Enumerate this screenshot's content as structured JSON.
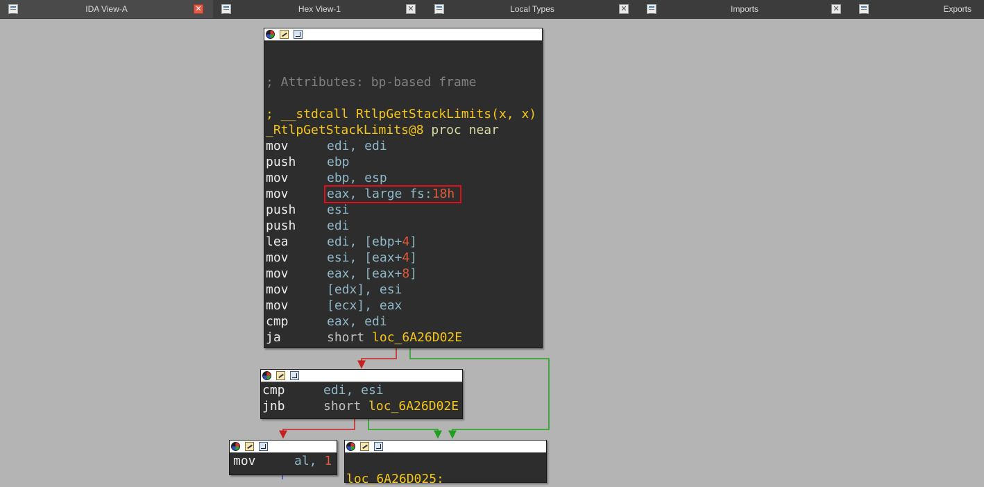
{
  "tabs": [
    {
      "label": "IDA View-A",
      "active": true,
      "close": "✕"
    },
    {
      "label": "Hex View-1",
      "active": false,
      "close": "✕"
    },
    {
      "label": "Local Types",
      "active": false,
      "close": "✕"
    },
    {
      "label": "Imports",
      "active": false,
      "close": "✕"
    },
    {
      "label": "Exports",
      "active": false,
      "close": ""
    }
  ],
  "node_main": {
    "attributes": "; Attributes: bp-based frame",
    "signature": "; __stdcall RtlpGetStackLimits(x, x)",
    "proc_name": "_RtlpGetStackLimits@8",
    "proc_kw": "proc near",
    "instructions": [
      {
        "mnemonic": "mov",
        "operands": "edi, edi"
      },
      {
        "mnemonic": "push",
        "operands": "ebp"
      },
      {
        "mnemonic": "mov",
        "operands": "ebp, esp"
      },
      {
        "mnemonic": "mov",
        "op_a": "eax, large fs:",
        "op_num": "18h"
      },
      {
        "mnemonic": "push",
        "operands": "esi"
      },
      {
        "mnemonic": "push",
        "operands": "edi"
      },
      {
        "mnemonic": "lea",
        "op_a": "edi, [ebp+",
        "op_num": "4",
        "op_b": "]"
      },
      {
        "mnemonic": "mov",
        "op_a": "esi, [eax+",
        "op_num": "4",
        "op_b": "]"
      },
      {
        "mnemonic": "mov",
        "op_a": "eax, [eax+",
        "op_num": "8",
        "op_b": "]"
      },
      {
        "mnemonic": "mov",
        "operands": "[edx], esi"
      },
      {
        "mnemonic": "mov",
        "operands": "[ecx], eax"
      },
      {
        "mnemonic": "cmp",
        "operands": "eax, edi"
      },
      {
        "mnemonic": "ja",
        "op_short": "short ",
        "op_label": "loc_6A26D02E"
      }
    ]
  },
  "node_cmp": {
    "instructions": [
      {
        "mnemonic": "cmp",
        "operands": "edi, esi"
      },
      {
        "mnemonic": "jnb",
        "op_short": "short ",
        "op_label": "loc_6A26D02E"
      }
    ]
  },
  "node_mov": {
    "mnemonic": "mov",
    "op_a": "al, ",
    "op_num": "1"
  },
  "node_loc": {
    "label": "loc_6A26D025:"
  },
  "colors": {
    "edge_false": "#c82020",
    "edge_true": "#20a020",
    "edge_normal": "#3050d0",
    "highlight": "#e0101a"
  }
}
